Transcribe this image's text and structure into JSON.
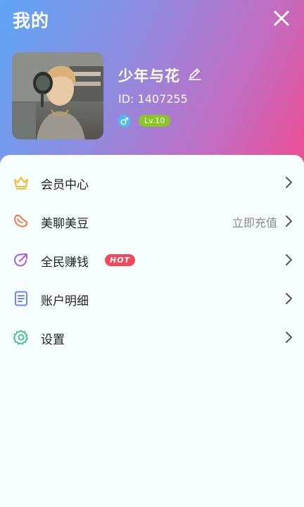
{
  "header": {
    "title": "我的",
    "close_icon": "close-icon"
  },
  "profile": {
    "nickname": "少年与花",
    "id_label": "ID:",
    "id_value": "1407255",
    "gender": "male",
    "level": "Lv.10"
  },
  "menu": {
    "items": [
      {
        "label": "会员中心",
        "icon": "crown-icon",
        "color": "#f3b93a"
      },
      {
        "label": "美聊美豆",
        "icon": "bean-icon",
        "color": "#f0784a",
        "side_text": "立即充值"
      },
      {
        "label": "全民赚钱",
        "icon": "share-arrow-icon",
        "color": "#a85ee8",
        "badge": "HOT"
      },
      {
        "label": "账户明细",
        "icon": "document-list-icon",
        "color": "#6d86ea"
      },
      {
        "label": "设置",
        "icon": "gear-icon",
        "color": "#3fc07f"
      }
    ]
  },
  "colors": {
    "gradient_start": "#5fa6f6",
    "gradient_end": "#ee4d92",
    "level_badge": "#8ac626",
    "hot_badge": "#f0495a",
    "gender_badge": "#4fb8f1"
  }
}
